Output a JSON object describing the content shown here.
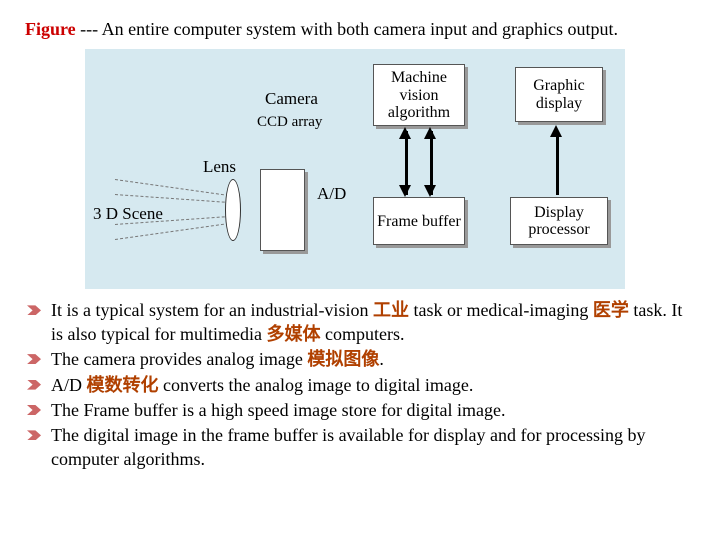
{
  "caption": {
    "label": "Figure",
    "text": " --- An entire computer system with both camera input and graphics output."
  },
  "diagram": {
    "scene": "3 D Scene",
    "lens": "Lens",
    "camera": "Camera",
    "ccd": "CCD array",
    "ad": "A/D",
    "mva": "Machine vision algorithm",
    "fb": "Frame buffer",
    "gd": "Graphic display",
    "dp": "Display processor"
  },
  "bullets": {
    "b1a": "It is a typical system for an industrial-vision ",
    "b1cjk1": "工业",
    "b1b": " task or medical-imaging ",
    "b1cjk2": "医学",
    "b1c": " task. It is also typical for multimedia ",
    "b1cjk3": "多媒体",
    "b1d": " computers.",
    "b2a": "The camera provides analog image ",
    "b2cjk": "模拟图像",
    "b2b": ".",
    "b3a": "A/D ",
    "b3cjk": "模数转化",
    "b3b": " converts the analog image to digital image.",
    "b4": "The Frame buffer is a high speed image store for digital image.",
    "b5": "The digital image in the frame buffer is available for display and for processing by computer algorithms."
  }
}
